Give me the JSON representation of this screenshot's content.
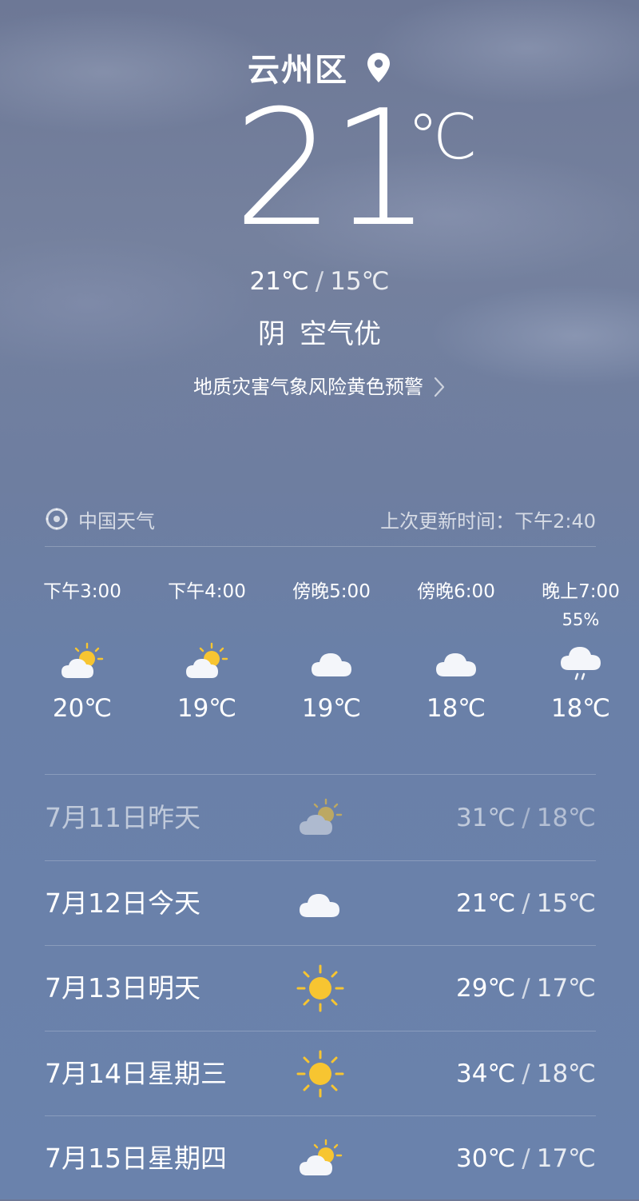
{
  "location": {
    "name": "云州区",
    "icon": "location-pin-icon"
  },
  "current": {
    "temperature": "21",
    "unit": "℃",
    "high": "21℃",
    "low": "15℃",
    "slash": "/",
    "condition": "阴",
    "air_quality": "空气优"
  },
  "alert": {
    "text": "地质灾害气象风险黄色预警",
    "icon": "chevron-right-icon"
  },
  "source": {
    "name": "中国天气",
    "icon": "swirl-logo-icon",
    "updated": "上次更新时间：下午2:40"
  },
  "hourly": [
    {
      "time": "下午3:00",
      "pop": "",
      "icon": "partly-cloudy-icon",
      "temp": "20℃"
    },
    {
      "time": "下午4:00",
      "pop": "",
      "icon": "partly-cloudy-icon",
      "temp": "19℃"
    },
    {
      "time": "傍晚5:00",
      "pop": "",
      "icon": "cloudy-icon",
      "temp": "19℃"
    },
    {
      "time": "傍晚6:00",
      "pop": "",
      "icon": "cloudy-icon",
      "temp": "18℃"
    },
    {
      "time": "晚上7:00",
      "pop": "55%",
      "icon": "light-rain-icon",
      "temp": "18℃"
    }
  ],
  "daily": [
    {
      "date": "7月11日昨天",
      "icon": "partly-cloudy-icon",
      "high": "31℃",
      "low": "18℃",
      "past": true
    },
    {
      "date": "7月12日今天",
      "icon": "cloudy-icon",
      "high": "21℃",
      "low": "15℃",
      "past": false
    },
    {
      "date": "7月13日明天",
      "icon": "sunny-icon",
      "high": "29℃",
      "low": "17℃",
      "past": false
    },
    {
      "date": "7月14日星期三",
      "icon": "sunny-icon",
      "high": "34℃",
      "low": "18℃",
      "past": false
    },
    {
      "date": "7月15日星期四",
      "icon": "partly-cloudy-icon",
      "high": "30℃",
      "low": "17℃",
      "past": false
    }
  ],
  "colors": {
    "sun": "#f7c531",
    "cloud": "#f4f6fa",
    "background": "#6a82ac"
  }
}
